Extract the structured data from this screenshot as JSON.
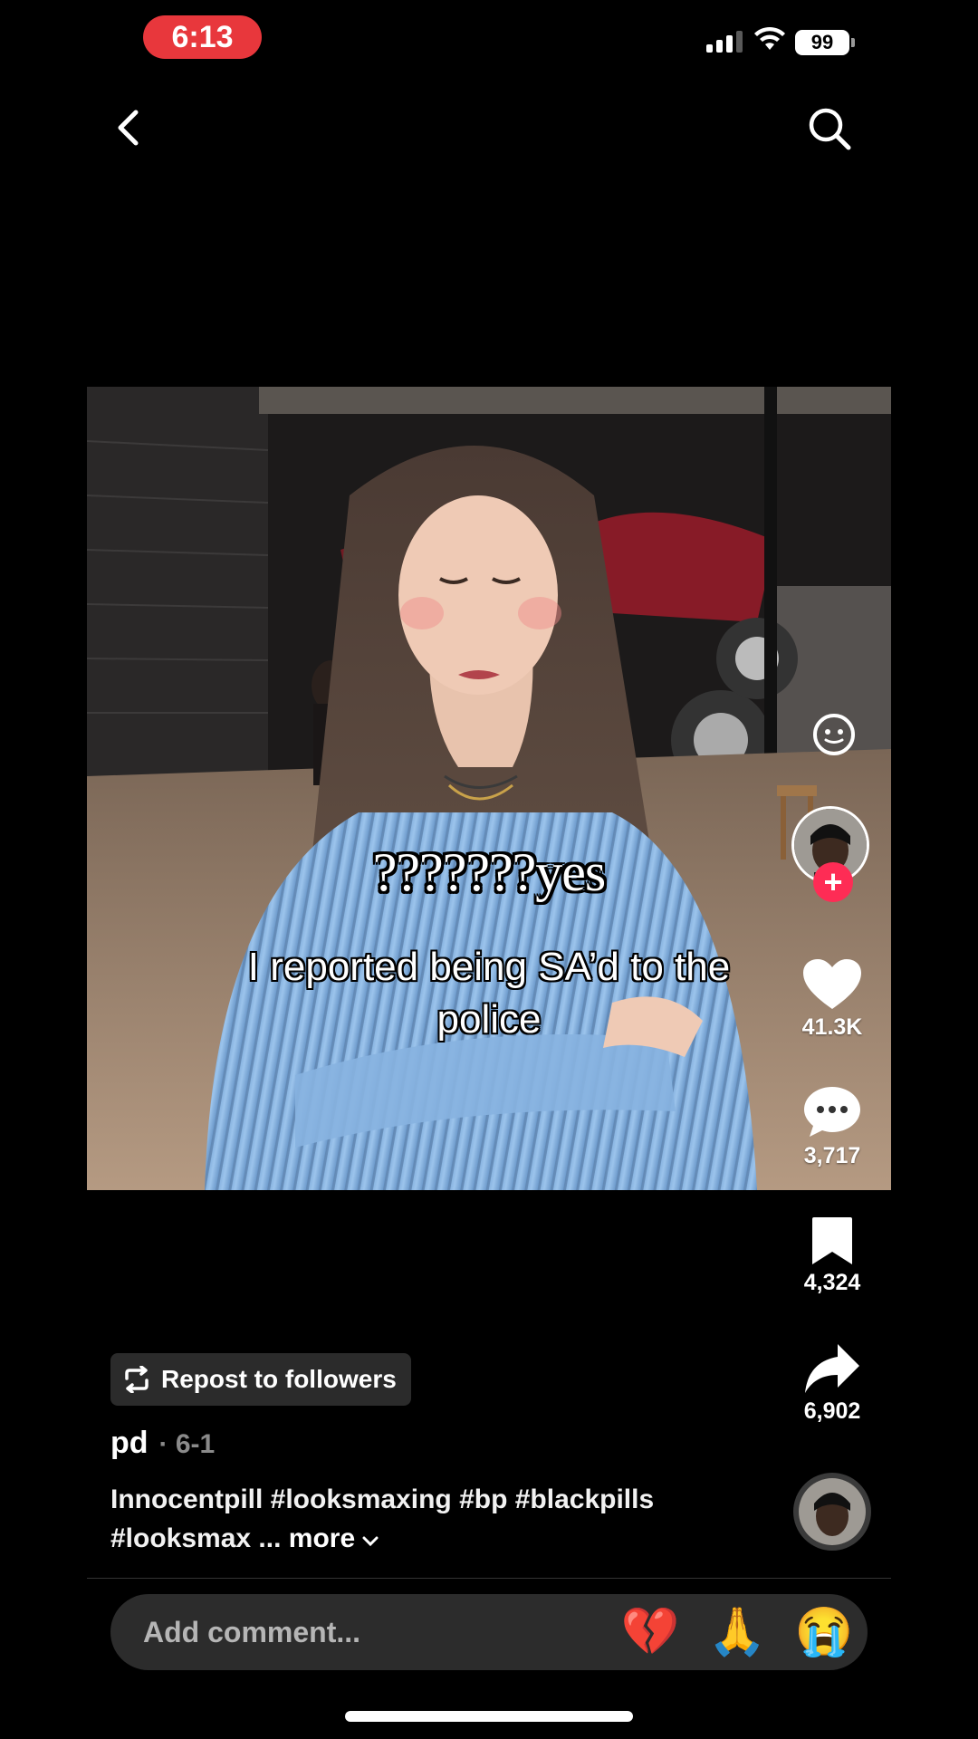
{
  "status_bar": {
    "time": "6:13",
    "battery": "99"
  },
  "nav": {
    "back_icon": "chevron-left-icon",
    "search_icon": "search-icon"
  },
  "video": {
    "overlay_top": "???????yes",
    "overlay_main": "I reported being SA’d to the police"
  },
  "rail": {
    "likes": "41.3K",
    "comments": "3,717",
    "saves": "4,324",
    "shares": "6,902",
    "follow_plus": "+"
  },
  "caption": {
    "repost_label": "Repost to followers",
    "author": "pd",
    "date": "· 6-1",
    "text": "Innocentpill #looksmaxing #bp #blackpills #looksmax ...",
    "more": "more"
  },
  "comment_bar": {
    "placeholder": "Add comment...",
    "emojis": [
      "💔",
      "🙏",
      "😭"
    ]
  },
  "colors": {
    "accent": "#fe2c55",
    "time_pill": "#e8373c"
  }
}
